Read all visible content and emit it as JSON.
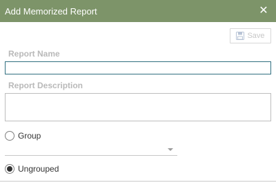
{
  "dialog": {
    "title": "Add Memorized Report",
    "close_icon": "close-icon",
    "header_color": "#7d9469"
  },
  "toolbar": {
    "save_label": "Save",
    "save_icon": "floppy-disk-icon",
    "save_enabled": false
  },
  "form": {
    "report_name_label": "Report Name",
    "report_name_value": "",
    "report_description_label": "Report Description",
    "report_description_value": "",
    "group_option_label": "Group",
    "group_option_selected": false,
    "group_select_value": "",
    "ungrouped_option_label": "Ungrouped",
    "ungrouped_option_selected": true
  }
}
